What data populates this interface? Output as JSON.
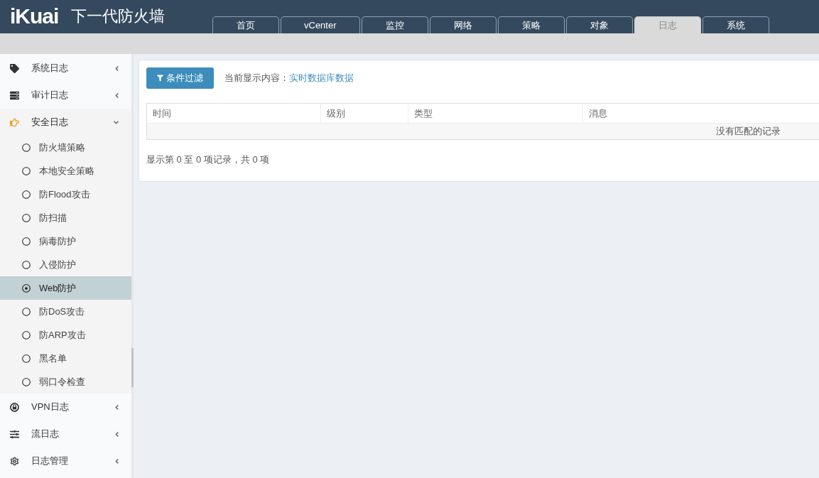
{
  "header": {
    "logo": "iKuai",
    "title": "下一代防火墙",
    "tabs": [
      {
        "label": "首页",
        "selected": false
      },
      {
        "label": "vCenter",
        "selected": false
      },
      {
        "label": "监控",
        "selected": false
      },
      {
        "label": "网络",
        "selected": false
      },
      {
        "label": "策略",
        "selected": false
      },
      {
        "label": "对象",
        "selected": false
      },
      {
        "label": "日志",
        "selected": true
      },
      {
        "label": "系统",
        "selected": false
      }
    ]
  },
  "sidebar": {
    "items": [
      {
        "label": "系统日志",
        "expanded": false
      },
      {
        "label": "审计日志",
        "expanded": false
      },
      {
        "label": "安全日志",
        "expanded": true,
        "children": [
          {
            "label": "防火墙策略",
            "selected": false
          },
          {
            "label": "本地安全策略",
            "selected": false
          },
          {
            "label": "防Flood攻击",
            "selected": false
          },
          {
            "label": "防扫描",
            "selected": false
          },
          {
            "label": "病毒防护",
            "selected": false
          },
          {
            "label": "入侵防护",
            "selected": false
          },
          {
            "label": "Web防护",
            "selected": true
          },
          {
            "label": "防DoS攻击",
            "selected": false
          },
          {
            "label": "防ARP攻击",
            "selected": false
          },
          {
            "label": "黑名单",
            "selected": false
          },
          {
            "label": "弱口令检查",
            "selected": false
          }
        ]
      },
      {
        "label": "VPN日志",
        "expanded": false
      },
      {
        "label": "流日志",
        "expanded": false
      },
      {
        "label": "日志管理",
        "expanded": false
      }
    ]
  },
  "content": {
    "filter_button": "条件过滤",
    "current_label": "当前显示内容：",
    "current_link": "实时数据库数据",
    "table": {
      "columns": [
        "时间",
        "级别",
        "类型",
        "消息"
      ],
      "empty_message": "没有匹配的记录"
    },
    "footer": "显示第 0 至 0 项记录，共 0 项"
  }
}
